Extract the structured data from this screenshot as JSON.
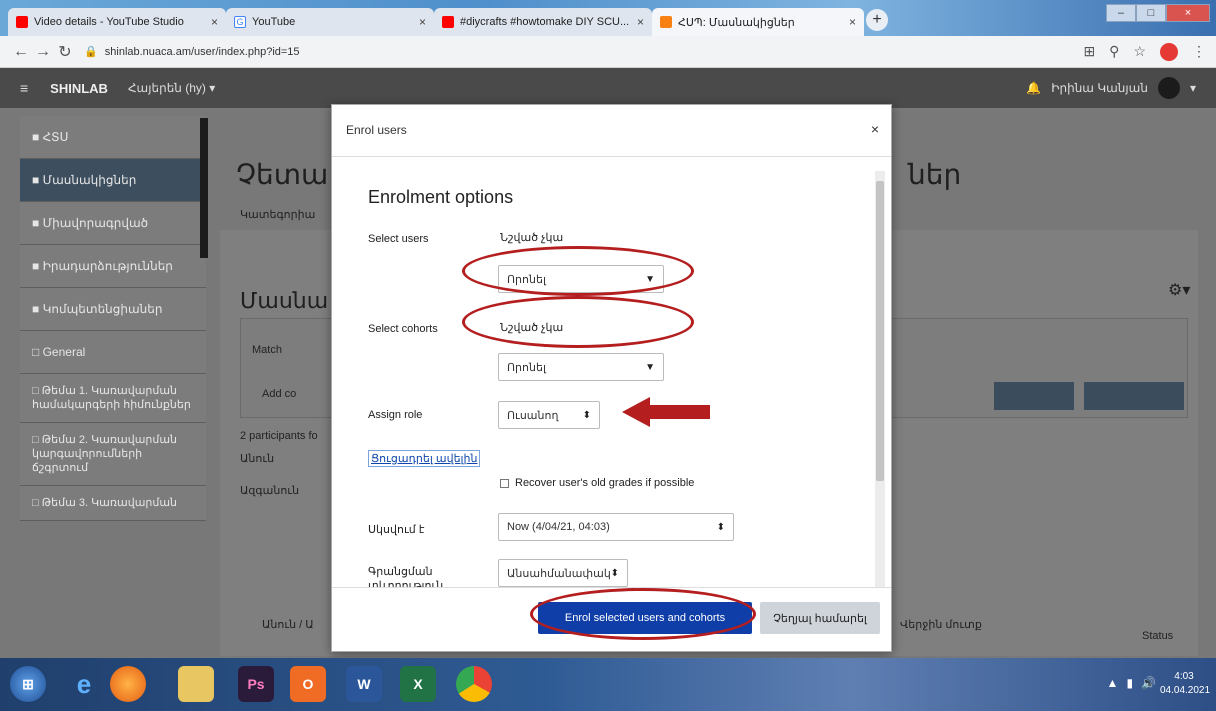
{
  "browser": {
    "tabs": [
      {
        "title": "Video details - YouTube Studio",
        "favicon_color": "#ff0000"
      },
      {
        "title": "YouTube",
        "favicon_color": "#4285f4"
      },
      {
        "title": "#diycrafts #howtomake DIY SCU...",
        "favicon_color": "#ff0000"
      },
      {
        "title": "ՀՍՊ: Մասնակիցներ",
        "favicon_color": "#f98012",
        "active": true
      }
    ],
    "url": "shinlab.nuaca.am/user/index.php?id=15"
  },
  "moodle": {
    "brand": "SHINLAB",
    "lang": "Հայերեն (hy) ▾",
    "user_name": "Իրինա Կանյան",
    "sidebar": [
      "ՀՏՍ",
      "Մասնակիցներ",
      "Միավորագրված",
      "Իրադարձություններ",
      "Կոմպետենցիաներ",
      "General",
      "Թեմա 1. Կառավարման համակարգերի հիմունքներ",
      "Թեմա 2. Կառավարման կարգավորումների ճշգրտում",
      "Թեմա 3. Կառավարման"
    ],
    "page_title_left": "Չետա",
    "page_title_right": "ներ",
    "section_title": "Մասնա",
    "breadcrumb": "Կատեգորիա",
    "participants_text": "2 participants fo",
    "match_label": "Match",
    "add_text": "Add co",
    "first_label": "Անուն",
    "last_label": "Ազգանուն",
    "col_name": "Անուն / Ա",
    "col_last_access": "Վերջին մուտք",
    "col_status": "Status"
  },
  "modal": {
    "title": "Enrol users",
    "close": "×",
    "heading": "Enrolment options",
    "select_users_label": "Select users",
    "select_users_value": "Նշված չկա",
    "search_placeholder": "Որոնել",
    "select_cohorts_label": "Select cohorts",
    "select_cohorts_value": "Նշված չկա",
    "cohorts_search_placeholder": "Որոնել",
    "assign_role_label": "Assign role",
    "assign_role_value": "Ուսանող",
    "show_more_link": "Ցուցադրել ավելին",
    "recover_grades_label": "Recover user's old grades if possible",
    "starting_from_label": "Սկսվում է",
    "starting_from_value": "Now (4/04/21, 04:03)",
    "duration_label": "Գրանցման տևողություն",
    "duration_value": "Անսահմանափակ է",
    "enrol_button": "Enrol selected users and cohorts",
    "cancel_button": "Չեղյալ համարել"
  },
  "taskbar": {
    "clock_time": "4:03",
    "clock_date": "04.04.2021"
  },
  "colors": {
    "annotation_red": "#b41e1e",
    "primary_button": "#0f3ea8"
  }
}
